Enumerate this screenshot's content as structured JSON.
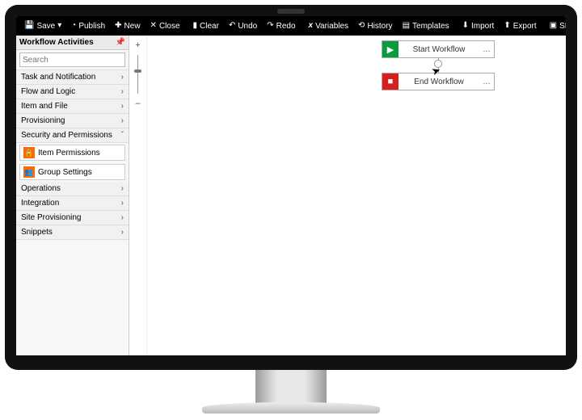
{
  "toolbar": {
    "save": "Save",
    "publish": "Publish",
    "new": "New",
    "close": "Close",
    "clear": "Clear",
    "undo": "Undo",
    "redo": "Redo",
    "variables": "Variables",
    "history": "History",
    "templates": "Templates",
    "import": "Import",
    "export": "Export",
    "form": "SPARK Initiation Form"
  },
  "panel": {
    "title": "Workflow Activities",
    "search_placeholder": "Search",
    "categories": [
      {
        "label": "Task and Notification",
        "expanded": false
      },
      {
        "label": "Flow and Logic",
        "expanded": false
      },
      {
        "label": "Item and File",
        "expanded": false
      },
      {
        "label": "Provisioning",
        "expanded": false
      },
      {
        "label": "Security and Permissions",
        "expanded": true,
        "items": [
          "Item Permissions",
          "Group Settings"
        ]
      },
      {
        "label": "Operations",
        "expanded": false
      },
      {
        "label": "Integration",
        "expanded": false
      },
      {
        "label": "Site Provisioning",
        "expanded": false
      },
      {
        "label": "Snippets",
        "expanded": false
      }
    ]
  },
  "zoom": {
    "plus": "+",
    "minus": "–"
  },
  "canvas": {
    "start_label": "Start Workflow",
    "end_label": "End Workflow"
  }
}
